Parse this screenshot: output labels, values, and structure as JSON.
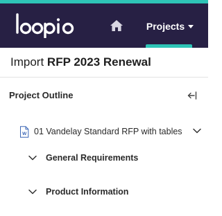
{
  "header": {
    "logo_text": "loopio",
    "home_icon": "home-icon",
    "projects_label": "Projects",
    "projects_caret_icon": "caret-down-icon",
    "colors": {
      "bar": "#272044",
      "accent": "#2ec4b6"
    }
  },
  "page": {
    "title_prefix": "Import",
    "title_name": "RFP 2023 Renewal"
  },
  "outline": {
    "title": "Project Outline",
    "collapse_icon": "collapse-left-icon",
    "document": {
      "icon": "word-document-icon",
      "label": "01 Vandelay Standard RFP with tables",
      "expanded": true
    },
    "sections": [
      {
        "label": "General Requirements",
        "expanded": false
      },
      {
        "label": "Product Information",
        "expanded": false
      }
    ]
  }
}
